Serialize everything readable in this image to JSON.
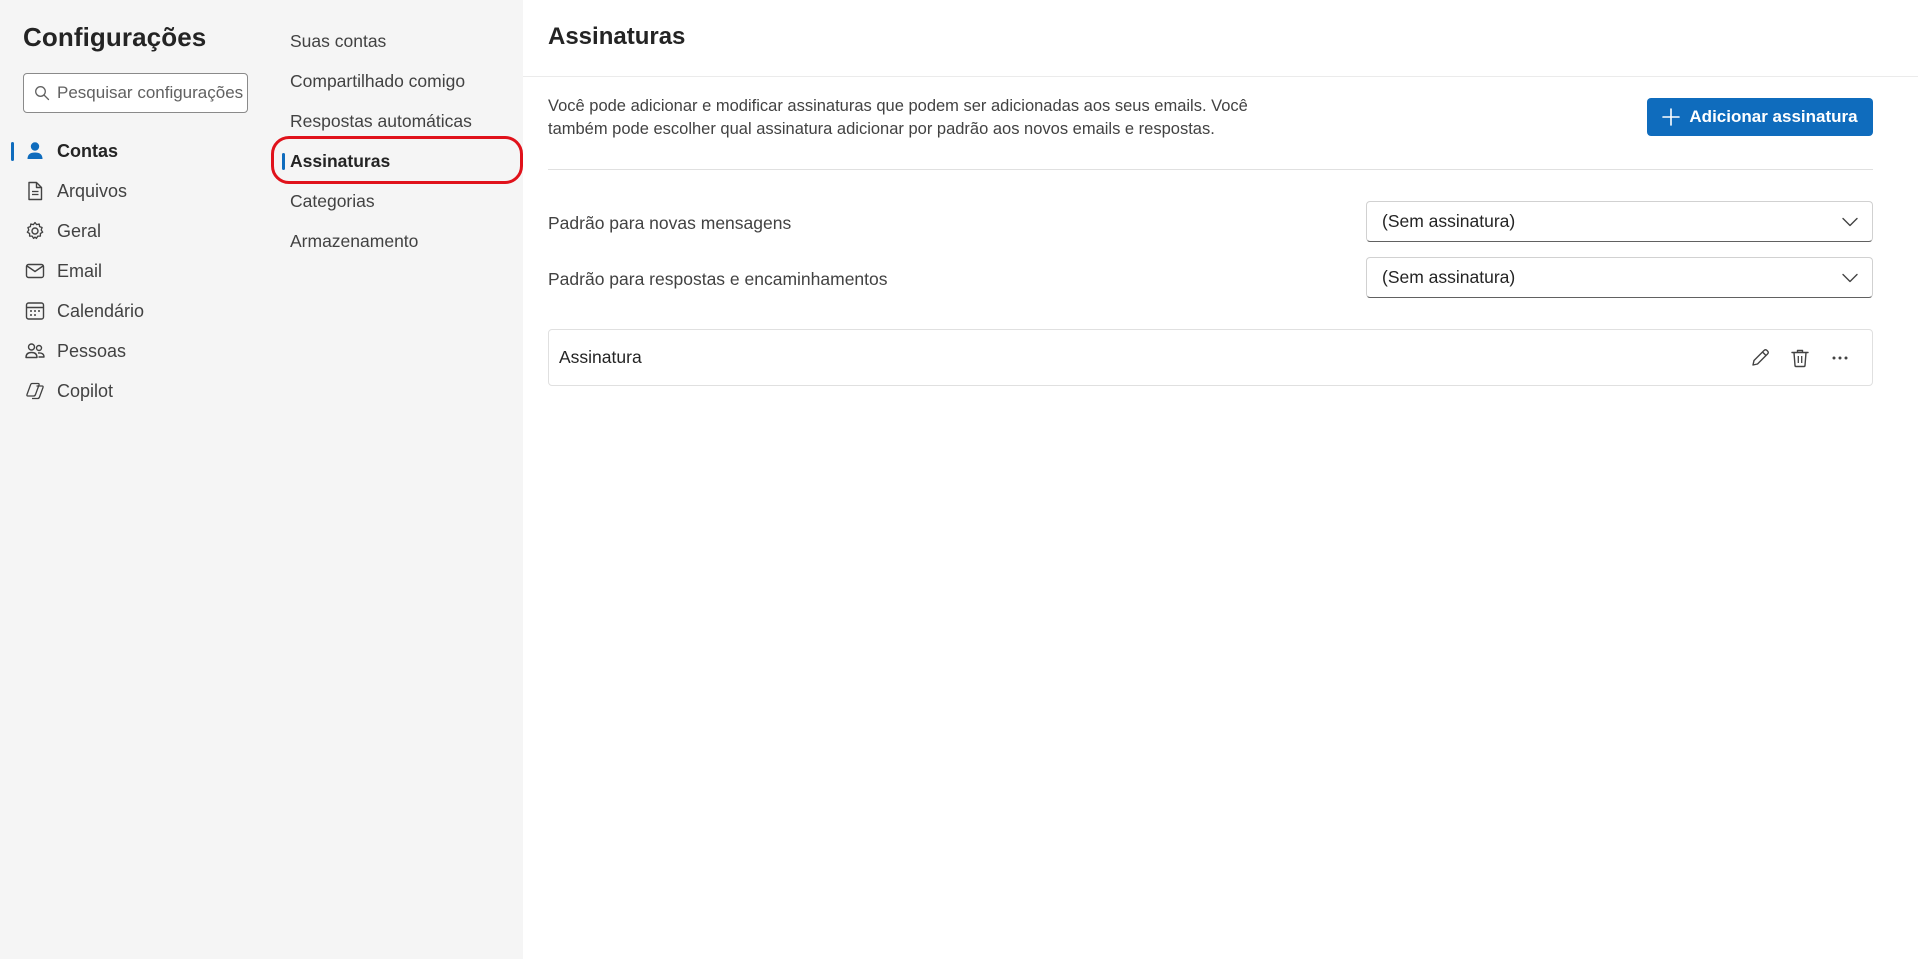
{
  "sidebar": {
    "title": "Configurações",
    "search_placeholder": "Pesquisar configurações",
    "items": [
      {
        "label": "Contas",
        "icon": "person-icon",
        "active": true
      },
      {
        "label": "Arquivos",
        "icon": "document-icon"
      },
      {
        "label": "Geral",
        "icon": "gear-icon"
      },
      {
        "label": "Email",
        "icon": "mail-icon"
      },
      {
        "label": "Calendário",
        "icon": "calendar-icon"
      },
      {
        "label": "Pessoas",
        "icon": "people-icon"
      },
      {
        "label": "Copilot",
        "icon": "copilot-icon"
      }
    ]
  },
  "subnav": {
    "items": [
      {
        "label": "Suas contas"
      },
      {
        "label": "Compartilhado comigo"
      },
      {
        "label": "Respostas automáticas"
      },
      {
        "label": "Assinaturas",
        "active": true
      },
      {
        "label": "Categorias"
      },
      {
        "label": "Armazenamento"
      }
    ]
  },
  "main": {
    "title": "Assinaturas",
    "description": "Você pode adicionar e modificar assinaturas que podem ser adicionadas aos seus emails. Você também pode escolher qual assinatura adicionar por padrão aos novos emails e respostas.",
    "add_button_label": "Adicionar assinatura",
    "defaults": [
      {
        "label": "Padrão para novas mensagens",
        "value": "(Sem assinatura)"
      },
      {
        "label": "Padrão para respostas e encaminhamentos",
        "value": "(Sem assinatura)"
      }
    ],
    "signature": {
      "name": "Assinatura",
      "actions": [
        "edit-icon",
        "delete-icon",
        "more-icon"
      ]
    }
  },
  "colors": {
    "accent": "#0f6cbd",
    "highlight_ring": "#e0121b"
  }
}
